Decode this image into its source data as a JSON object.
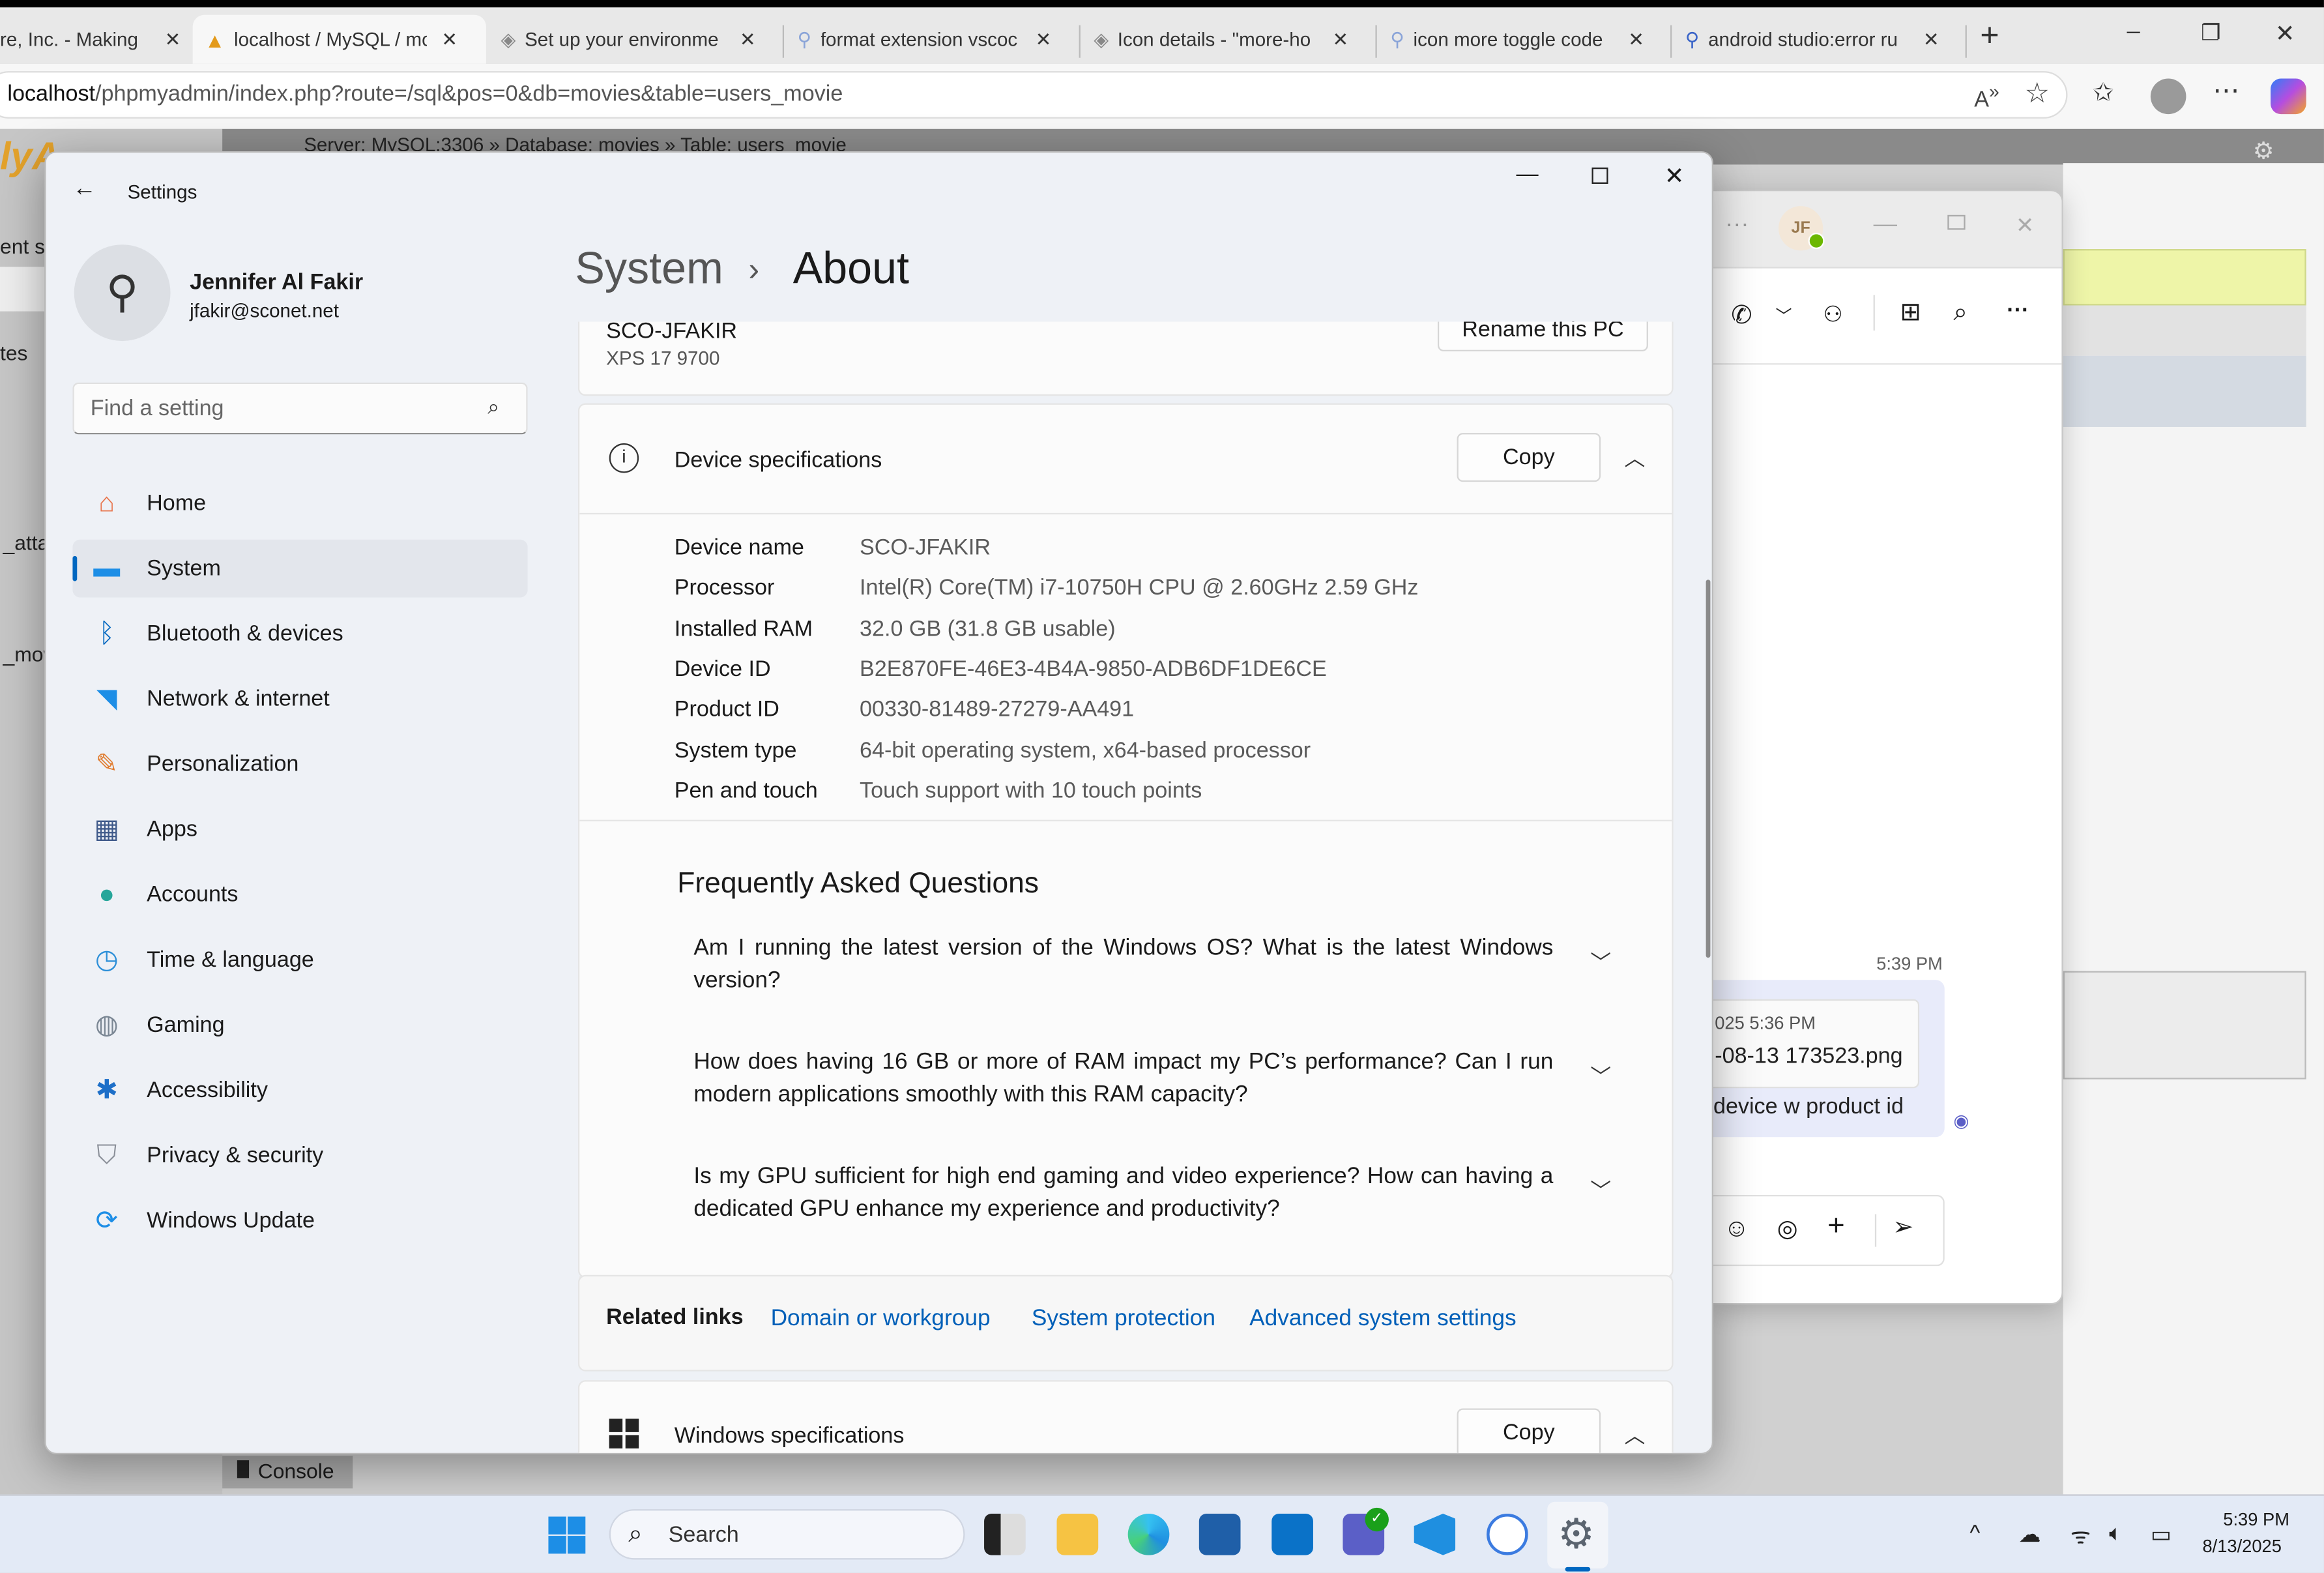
{
  "browser": {
    "tabs": [
      {
        "title": "re, Inc. - Making"
      },
      {
        "title": "localhost / MySQL / mo"
      },
      {
        "title": "Set up your environme"
      },
      {
        "title": "format extension vscoc"
      },
      {
        "title": "Icon details - \"more-ho"
      },
      {
        "title": "icon more toggle code"
      },
      {
        "title": "android studio:error ru"
      }
    ],
    "new_tab": "+",
    "address_host": "localhost",
    "address_path": "/phpmyadmin/index.php?route=/sql&pos=0&db=movies&table=users_movie"
  },
  "background_app": {
    "breadcrumb": "Server: MySQL:3306  »  Database: movies  »  Table: users_movie",
    "left_fragments": [
      "ent se",
      "tes",
      "_atta",
      "_mov"
    ],
    "console_label": "Console"
  },
  "settings": {
    "title": "Settings",
    "user": {
      "name": "Jennifer Al Fakir",
      "email": "jfakir@sconet.net"
    },
    "search_placeholder": "Find a setting",
    "nav": [
      {
        "label": "Home",
        "icon": "home-icon"
      },
      {
        "label": "System",
        "icon": "system-icon",
        "selected": true
      },
      {
        "label": "Bluetooth & devices",
        "icon": "bluetooth-icon"
      },
      {
        "label": "Network & internet",
        "icon": "wifi-icon"
      },
      {
        "label": "Personalization",
        "icon": "brush-icon"
      },
      {
        "label": "Apps",
        "icon": "apps-icon"
      },
      {
        "label": "Accounts",
        "icon": "accounts-icon"
      },
      {
        "label": "Time & language",
        "icon": "time-language-icon"
      },
      {
        "label": "Gaming",
        "icon": "gaming-icon"
      },
      {
        "label": "Accessibility",
        "icon": "accessibility-icon"
      },
      {
        "label": "Privacy & security",
        "icon": "shield-icon"
      },
      {
        "label": "Windows Update",
        "icon": "update-icon"
      }
    ],
    "breadcrumb_parent": "System",
    "breadcrumb_sep": "›",
    "page_title": "About",
    "pc": {
      "name": "SCO-JFAKIR",
      "model": "XPS 17 9700",
      "rename_label": "Rename this PC"
    },
    "device_specs": {
      "title": "Device specifications",
      "copy_label": "Copy",
      "rows": [
        {
          "label": "Device name",
          "value": "SCO-JFAKIR"
        },
        {
          "label": "Processor",
          "value": "Intel(R) Core(TM) i7-10750H CPU @ 2.60GHz   2.59 GHz"
        },
        {
          "label": "Installed RAM",
          "value": "32.0 GB (31.8 GB usable)"
        },
        {
          "label": "Device ID",
          "value": "B2E870FE-46E3-4B4A-9850-ADB6DF1DE6CE"
        },
        {
          "label": "Product ID",
          "value": "00330-81489-27279-AA491"
        },
        {
          "label": "System type",
          "value": "64-bit operating system, x64-based processor"
        },
        {
          "label": "Pen and touch",
          "value": "Touch support with 10 touch points"
        }
      ]
    },
    "faq": {
      "title": "Frequently Asked Questions",
      "items": [
        "Am I running the latest version of the Windows OS? What is the latest Windows version?",
        "How does having 16 GB or more of RAM impact my PC’s performance? Can I run modern applications smoothly with this RAM capacity?",
        "Is my GPU sufficient for high end gaming and video experience? How can having a dedicated GPU enhance my experience and productivity?"
      ]
    },
    "related": {
      "label": "Related links",
      "links": [
        "Domain or workgroup",
        "System protection",
        "Advanced system settings"
      ]
    },
    "windows_specs": {
      "title": "Windows specifications",
      "copy_label": "Copy"
    }
  },
  "teams": {
    "avatar_initials": "JF",
    "timestamp": "5:39 PM",
    "attachment_time": "025 5:36 PM",
    "attachment_name": "-08-13 173523.png",
    "message": "device w product id"
  },
  "taskbar": {
    "search_placeholder": "Search",
    "time": "5:39 PM",
    "date": "8/13/2025"
  },
  "colors": {
    "accent": "#0067c0",
    "link": "#005fb8",
    "teams_bubble": "#e8ebfa"
  }
}
